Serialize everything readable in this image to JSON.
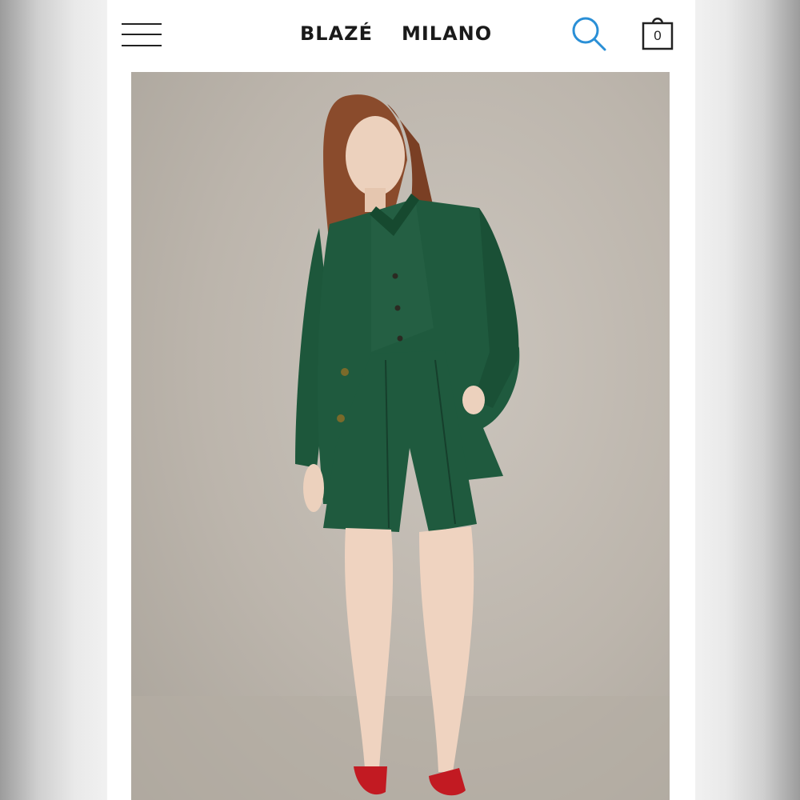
{
  "brand": {
    "name_part1": "BLAZÉ",
    "name_part2": "MILANO"
  },
  "header": {
    "menu_icon": "hamburger-menu-icon",
    "search_icon": "search-icon",
    "cart_icon": "shopping-bag-icon",
    "cart_count": "0"
  },
  "colors": {
    "accent": "#2a8fd6",
    "outfit": "#1f5a3e",
    "background": "#bdb6ad",
    "shoes": "#c21a22"
  },
  "hero_image": {
    "subject": "model-in-green-blazer-shirt-and-shorts"
  }
}
